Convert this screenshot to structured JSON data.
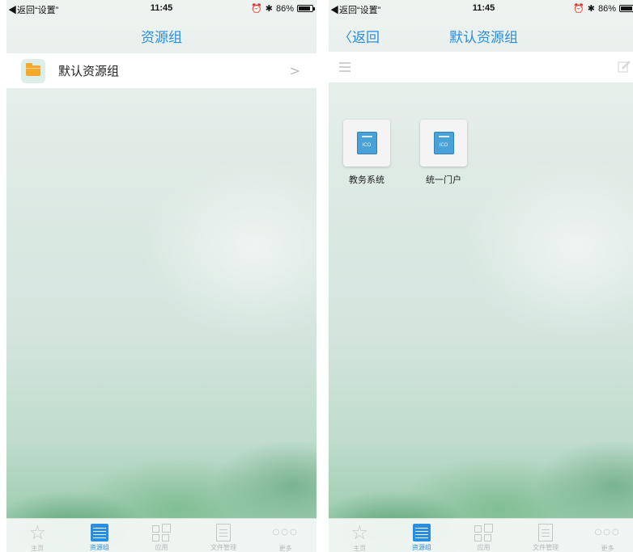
{
  "status": {
    "back_label": "◀返回“设置”",
    "time": "11:45",
    "battery": "86%",
    "alarm_icon": "alarm-icon",
    "bluetooth_icon": "bluetooth-icon"
  },
  "left_screen": {
    "nav_title": "资源组",
    "groups": [
      {
        "label": "默认资源组",
        "icon": "folder-icon",
        "chevron": ">"
      }
    ]
  },
  "right_screen": {
    "back_button": "〈返回",
    "nav_title": "默认资源组",
    "toolbar": {
      "list_icon": "list-icon",
      "edit_icon": "edit-icon"
    },
    "apps": [
      {
        "name": "教务系统",
        "icon_text": "ICO"
      },
      {
        "name": "统一门户",
        "icon_text": "ICO"
      }
    ]
  },
  "tabbar": {
    "tabs": [
      {
        "label": "主页",
        "icon": "star-icon"
      },
      {
        "label": "资源组",
        "icon": "resource-list-icon",
        "active": true
      },
      {
        "label": "应用",
        "icon": "apps-grid-icon"
      },
      {
        "label": "文件管理",
        "icon": "file-icon"
      },
      {
        "label": "更多",
        "icon": "more-icon"
      }
    ]
  },
  "colors": {
    "accent": "#2a8ee0",
    "folder": "#f4a92c",
    "app_icon": "#4aa1d8"
  }
}
